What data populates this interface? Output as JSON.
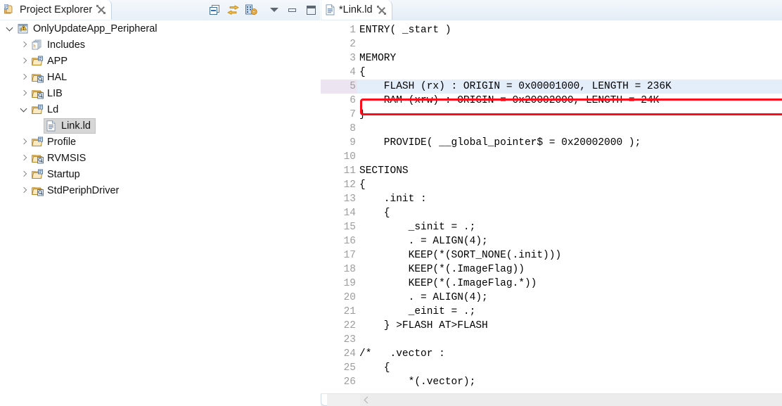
{
  "explorer": {
    "tab": {
      "title": "Project Explorer",
      "icon": "project-explorer-icon",
      "close_icon": "close-icon"
    },
    "toolbar": [
      {
        "name": "collapse-all-button",
        "icon": "collapse-all-icon"
      },
      {
        "name": "link-with-editor-button",
        "icon": "link-with-editor-icon"
      },
      {
        "name": "view-menu-button",
        "icon": "view-menu-icon"
      },
      {
        "name": "view-dropdown-button",
        "icon": "chevron-down-icon"
      },
      {
        "name": "minimize-button",
        "icon": "minimize-icon"
      },
      {
        "name": "maximize-button",
        "icon": "maximize-icon"
      }
    ],
    "tree": [
      {
        "label": "OnlyUpdateApp_Peripheral",
        "depth": 0,
        "twisty": "down",
        "icon": "project-warning-icon",
        "selected": false
      },
      {
        "label": "Includes",
        "depth": 1,
        "twisty": "right",
        "icon": "includes-icon",
        "selected": false
      },
      {
        "label": "APP",
        "depth": 1,
        "twisty": "right",
        "icon": "source-folder-icon",
        "selected": false
      },
      {
        "label": "HAL",
        "depth": 1,
        "twisty": "right",
        "icon": "folder-search-icon",
        "selected": false
      },
      {
        "label": "LIB",
        "depth": 1,
        "twisty": "right",
        "icon": "folder-search-icon",
        "selected": false
      },
      {
        "label": "Ld",
        "depth": 1,
        "twisty": "down",
        "icon": "source-folder-icon",
        "selected": false
      },
      {
        "label": "Link.ld",
        "depth": 2,
        "twisty": "none",
        "icon": "file-icon",
        "selected": true
      },
      {
        "label": "Profile",
        "depth": 1,
        "twisty": "right",
        "icon": "source-folder-icon",
        "selected": false
      },
      {
        "label": "RVMSIS",
        "depth": 1,
        "twisty": "right",
        "icon": "folder-search-icon",
        "selected": false
      },
      {
        "label": "Startup",
        "depth": 1,
        "twisty": "right",
        "icon": "source-folder-icon",
        "selected": false
      },
      {
        "label": "StdPeriphDriver",
        "depth": 1,
        "twisty": "right",
        "icon": "folder-search-icon",
        "selected": false
      }
    ]
  },
  "editor": {
    "tab": {
      "title": "*Link.ld",
      "icon": "file-icon",
      "close_icon": "close-icon"
    },
    "current_line": 5,
    "annotation": {
      "color": "#fc0d1b",
      "target_line": 5
    },
    "lines": [
      {
        "n": "1",
        "text": "ENTRY( _start )"
      },
      {
        "n": "2",
        "text": ""
      },
      {
        "n": "3",
        "text": "MEMORY"
      },
      {
        "n": "4",
        "text": "{"
      },
      {
        "n": "5",
        "text": "    FLASH (rx) : ORIGIN = 0x00001000, LENGTH = 236K"
      },
      {
        "n": "6",
        "text": "    RAM (xrw) : ORIGIN = 0x20002000, LENGTH = 24K"
      },
      {
        "n": "7",
        "text": "}"
      },
      {
        "n": "8",
        "text": ""
      },
      {
        "n": "9",
        "text": "    PROVIDE( __global_pointer$ = 0x20002000 );"
      },
      {
        "n": "10",
        "text": ""
      },
      {
        "n": "11",
        "text": "SECTIONS"
      },
      {
        "n": "12",
        "text": "{"
      },
      {
        "n": "13",
        "text": "    .init :"
      },
      {
        "n": "14",
        "text": "    {"
      },
      {
        "n": "15",
        "text": "        _sinit = .;"
      },
      {
        "n": "16",
        "text": "        . = ALIGN(4);"
      },
      {
        "n": "17",
        "text": "        KEEP(*(SORT_NONE(.init)))"
      },
      {
        "n": "18",
        "text": "        KEEP(*(.ImageFlag))"
      },
      {
        "n": "19",
        "text": "        KEEP(*(.ImageFlag.*))"
      },
      {
        "n": "20",
        "text": "        . = ALIGN(4);"
      },
      {
        "n": "21",
        "text": "        _einit = .;"
      },
      {
        "n": "22",
        "text": "    } >FLASH AT>FLASH"
      },
      {
        "n": "23",
        "text": ""
      },
      {
        "n": "24",
        "text": "/*   .vector :"
      },
      {
        "n": "25",
        "text": "    {"
      },
      {
        "n": "26",
        "text": "        *(.vector);"
      }
    ],
    "scrollbar": {
      "name": "horizontal-scrollbar",
      "left_arrow_icon": "chevron-left-icon"
    }
  }
}
